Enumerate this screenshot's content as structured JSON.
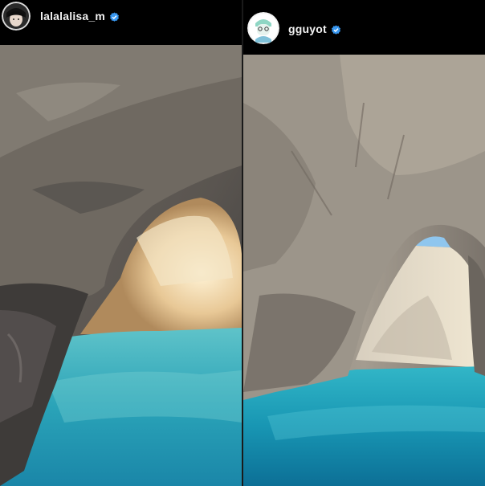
{
  "posts": [
    {
      "username": "lalalalisa_m",
      "verified": true,
      "avatar_icon": "profile-photo-avatar",
      "photo": "sea-cave-arch-photo"
    },
    {
      "username": "gguyot",
      "verified": true,
      "avatar_icon": "cartoon-avatar",
      "photo": "sea-arch-rock-photo"
    }
  ],
  "colors": {
    "background": "#000000",
    "username_text": "#f2f2f2",
    "verified_badge": "#3897f0",
    "water": "#1fa0b8",
    "rock": "#8a8279"
  }
}
